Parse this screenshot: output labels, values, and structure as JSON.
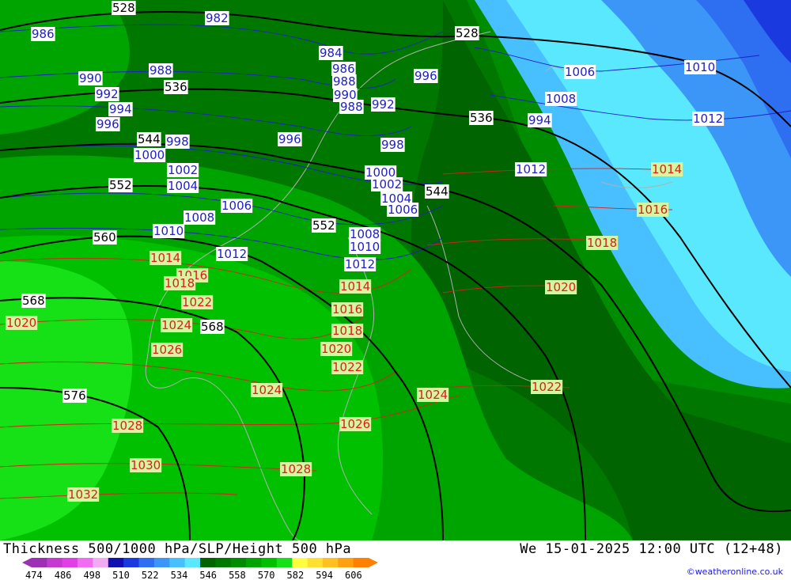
{
  "title": "Thickness 500/1000 hPa/SLP/Height 500 hPa",
  "valid_time": "We 15-01-2025 12:00 UTC (12+48)",
  "credit": "©weatheronline.co.uk",
  "legend": {
    "ticks": [
      "474",
      "486",
      "498",
      "510",
      "522",
      "534",
      "546",
      "558",
      "570",
      "582",
      "594",
      "606"
    ],
    "colors": [
      "#9c2fb4",
      "#c43ad0",
      "#e23ee6",
      "#f06cf0",
      "#f2aaf2",
      "#1010b0",
      "#1a3ae0",
      "#2e6ef0",
      "#3c96f8",
      "#48c0ff",
      "#5ae8ff",
      "#006400",
      "#007800",
      "#008c00",
      "#00a400",
      "#00c000",
      "#16e016",
      "#ffff40",
      "#ffe030",
      "#ffc020",
      "#ffa010",
      "#ff8000"
    ]
  },
  "colors": {
    "slp_low": "#2020c8",
    "slp_high": "#d8201c",
    "height": "#000000",
    "label_bg": "#ffffff",
    "label_bg_warm": "#d6f5a0"
  },
  "height_labels": [
    "528",
    "528",
    "536",
    "536",
    "544",
    "544",
    "552",
    "552",
    "560",
    "568",
    "568",
    "576"
  ],
  "slp_low_labels": [
    "986",
    "982",
    "984",
    "986",
    "988",
    "990",
    "988",
    "992",
    "994",
    "996",
    "998",
    "1000",
    "1002",
    "1004",
    "996",
    "998",
    "996",
    "1000",
    "1002",
    "1004",
    "1006",
    "1008",
    "1010",
    "1012",
    "1006",
    "1008",
    "1010",
    "1012",
    "1008",
    "1010",
    "1012",
    "1006",
    "1012",
    "990",
    "988",
    "992",
    "994"
  ],
  "slp_high_labels": [
    "1014",
    "1016",
    "1018",
    "1020",
    "1022",
    "1024",
    "1026",
    "1014",
    "1016",
    "1018",
    "1020",
    "1022",
    "1024",
    "1026",
    "1028",
    "1030",
    "1032",
    "1024",
    "1022",
    "1020",
    "1018",
    "1016",
    "1014",
    "1020",
    "1028",
    "1022"
  ]
}
